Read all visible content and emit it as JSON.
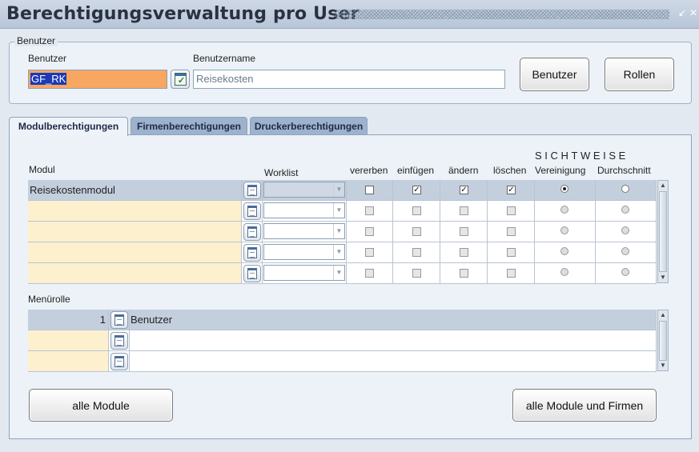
{
  "window": {
    "title": "Berechtigungsverwaltung pro User"
  },
  "group": {
    "legend": "Benutzer",
    "user_label": "Benutzer",
    "user_value": "GF_RK",
    "username_label": "Benutzername",
    "username_value": "Reisekosten",
    "btn_user": "Benutzer",
    "btn_roles": "Rollen"
  },
  "tabs": [
    "Modulberechtigungen",
    "Firmenberechtigungen",
    "Druckerberechtigungen"
  ],
  "grid": {
    "col_modul": "Modul",
    "col_worklist": "Worklist",
    "col_vererben": "vererben",
    "col_einfuegen": "einfügen",
    "col_aendern": "ändern",
    "col_loeschen": "löschen",
    "group_sichtweise": "SICHTWEISE",
    "col_vereinigung": "Vereinigung",
    "col_durchschnitt": "Durchschnitt",
    "rows": [
      {
        "modul": "Reisekostenmodul",
        "vererben": false,
        "einfuegen": true,
        "aendern": true,
        "loeschen": true,
        "sicht": "Vereinigung"
      },
      {
        "modul": "",
        "vererben": false,
        "einfuegen": false,
        "aendern": false,
        "loeschen": false,
        "sicht": ""
      },
      {
        "modul": "",
        "vererben": false,
        "einfuegen": false,
        "aendern": false,
        "loeschen": false,
        "sicht": ""
      },
      {
        "modul": "",
        "vererben": false,
        "einfuegen": false,
        "aendern": false,
        "loeschen": false,
        "sicht": ""
      },
      {
        "modul": "",
        "vererben": false,
        "einfuegen": false,
        "aendern": false,
        "loeschen": false,
        "sicht": ""
      }
    ]
  },
  "menu": {
    "label": "Menürolle",
    "rows": [
      {
        "num": "1",
        "name": "Benutzer"
      },
      {
        "num": "",
        "name": ""
      },
      {
        "num": "",
        "name": ""
      }
    ]
  },
  "buttons": {
    "all_modules": "alle Module",
    "all_modules_firms": "alle Module und Firmen"
  },
  "colors": {
    "highlight_field": "#f7a760",
    "empty_cell": "#fdf0cf",
    "selected_row": "#c3cfdd"
  }
}
